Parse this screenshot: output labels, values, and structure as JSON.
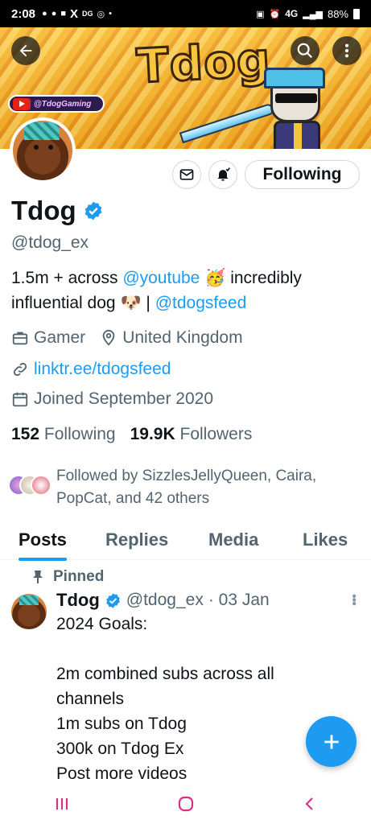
{
  "status_bar": {
    "time": "2:08",
    "network": "4G",
    "battery": "88%"
  },
  "banner": {
    "title": "Tdog",
    "channel_tag": "@TdogGaming"
  },
  "profile": {
    "display_name": "Tdog",
    "verified": true,
    "handle": "@tdog_ex",
    "follow_button": "Following",
    "bio": {
      "part1": "1.5m + across ",
      "mention1": "@youtube",
      "emoji1": "🥳",
      "part2": " incredibly influential dog ",
      "emoji2": "🐶",
      "part3": " | ",
      "mention2": "@tdogsfeed"
    },
    "category": "Gamer",
    "location": "United Kingdom",
    "website": "linktr.ee/tdogsfeed",
    "joined": "Joined September 2020",
    "following_count": "152",
    "following_label": "Following",
    "followers_count": "19.9K",
    "followers_label": "Followers",
    "followed_by": "Followed by SizzlesJellyQueen, Caira, PopCat, and 42 others"
  },
  "tabs": [
    "Posts",
    "Replies",
    "Media",
    "Likes"
  ],
  "active_tab": "Posts",
  "pinned_post": {
    "pinned_label": "Pinned",
    "author_name": "Tdog",
    "author_handle": "@tdog_ex",
    "date": "· 03 Jan",
    "lines": [
      "2024 Goals:",
      "",
      "2m combined subs across all",
      "channels",
      "1m subs on Tdog",
      "300k on Tdog Ex",
      "Post more videos"
    ]
  },
  "colors": {
    "accent": "#1d9bf0",
    "secondary_text": "#536471",
    "nav_icon": "#d63384"
  },
  "icons": {
    "back": "arrow-left-icon",
    "search": "search-icon",
    "more": "more-vertical-icon",
    "message": "envelope-icon",
    "notify": "bell-icon",
    "compose": "plus-icon"
  }
}
